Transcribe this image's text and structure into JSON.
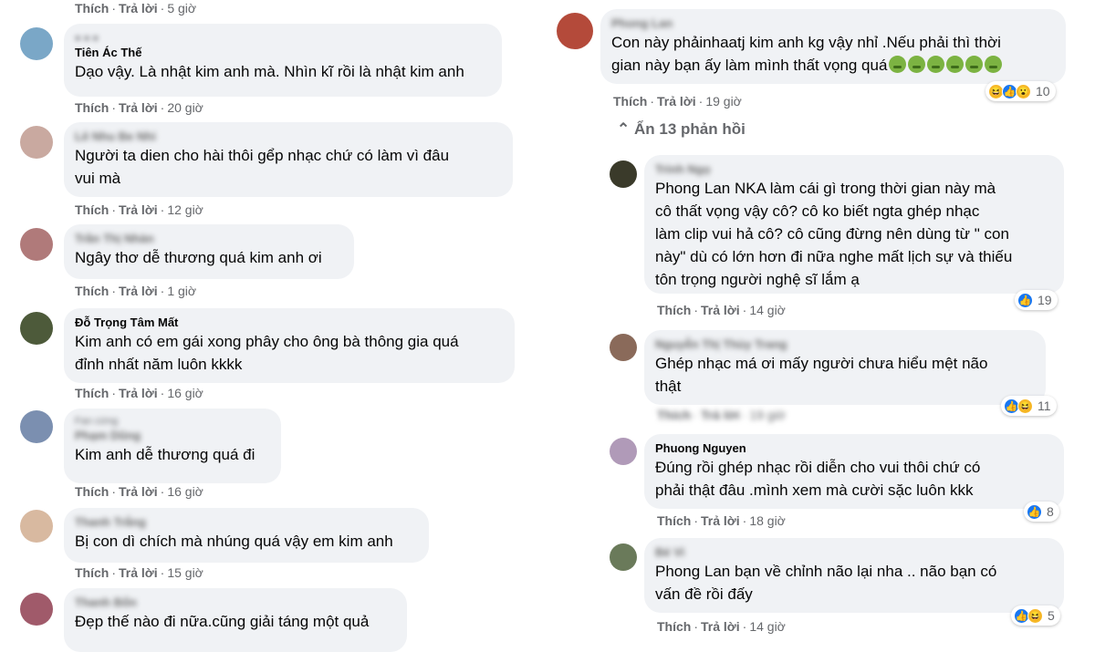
{
  "actions": {
    "like": "Thích",
    "reply": "Trả lời"
  },
  "left_comments": [
    {
      "time": "5 giờ"
    },
    {
      "name": "Tiên Ác Thế",
      "text_lines": [
        "Dạo vậy. Là nhật kim anh mà. Nhìn kĩ rồi là nhật kim anh"
      ],
      "time": "20 giờ"
    },
    {
      "name": "Lê Nhu Be Nhi",
      "text_lines": [
        "Người ta dien cho hài thôi gểp nhạc chứ có làm vì đâu",
        "vui mà"
      ],
      "time": "12 giờ"
    },
    {
      "name": "Trần Thị Nhàn",
      "text_lines": [
        "Ngây thơ dễ thương quá kim anh ơi"
      ],
      "time": "1 giờ"
    },
    {
      "name": "Đỗ Trọng Tâm Mất",
      "text_lines": [
        "Kim anh có em gái xong phây cho ông bà thông gia quá",
        "đỉnh nhất năm luôn kkkk"
      ],
      "time": "16 giờ"
    },
    {
      "badge": "Fan cứng",
      "name": "Phạm Dũng",
      "text_lines": [
        "Kim anh dễ thương quá đi"
      ],
      "time": "16 giờ"
    },
    {
      "name": "Thanh Trắng",
      "text_lines": [
        "Bị con dì chích mà nhúng quá vậy em kim anh"
      ],
      "time": "15 giờ"
    },
    {
      "name": "Thanh Bốn",
      "text_lines": [
        "Đẹp thế nào đi nữa.cũng giải táng một quả"
      ]
    }
  ],
  "right_top": {
    "name": "Phong Lan",
    "text_lines": [
      "Con này phảinhaatj kim anh kg vậy nhỉ .Nếu phải thì thời",
      "gian này bạn ấy làm mình thất vọng quá"
    ],
    "time": "19 giờ",
    "reaction_count": "10"
  },
  "hide_replies": "Ẩn 13 phản hồi",
  "replies": [
    {
      "name": "Trinh Ngọ",
      "text_lines": [
        "Phong Lan NKA làm cái gì trong thời gian này mà",
        "cô thất vọng vậy cô? cô ko biết ngta ghép nhạc",
        "làm clip vui hả cô? cô cũng đừng nên dùng từ \" con",
        "này\" dù có lớn hơn đi nữa nghe mất lịch sự và thiếu",
        "tôn trọng người nghệ sĩ lắm ạ"
      ],
      "time": "14 giờ",
      "reaction_count": "19"
    },
    {
      "name": "Nguyễn Thị Thùy Trang",
      "text_lines": [
        "Ghép nhạc má ơi mấy người chưa hiểu mệt não",
        "thật"
      ],
      "time": "19 giờ",
      "reaction_count": "11"
    },
    {
      "name": "Phuong Nguyen",
      "text_lines": [
        "Đúng rồi ghép nhạc rồi diễn cho vui thôi chứ có",
        "phải thật đâu .mình xem mà cười sặc luôn kkk"
      ],
      "time": "18 giờ",
      "reaction_count": "8"
    },
    {
      "name": "Bé Vi",
      "text_lines": [
        "Phong Lan bạn về chỉnh não lại nha .. não bạn có",
        "vấn đề rồi đấy"
      ],
      "time": "14 giờ",
      "reaction_count": "5"
    }
  ],
  "colors": {
    "bubble": "#f0f2f5",
    "meta": "#65676b",
    "like_blue": "#1877f2",
    "haha_yellow": "#f7b928"
  }
}
